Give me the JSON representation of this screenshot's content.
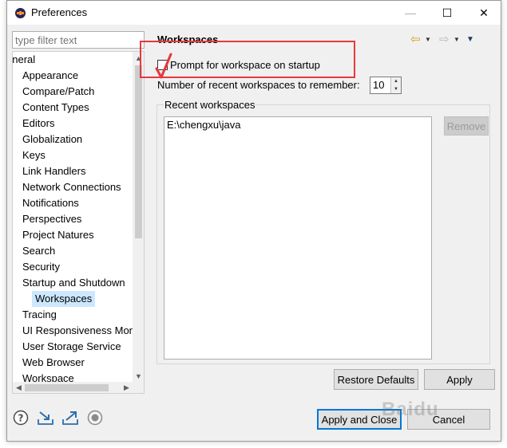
{
  "window": {
    "title": "Preferences"
  },
  "titlebar_buttons": {
    "minimize": "—",
    "maximize": "☐",
    "close": "✕"
  },
  "filter": {
    "placeholder": "type filter text"
  },
  "tree": {
    "items": [
      {
        "label": "eneral",
        "level": 0
      },
      {
        "label": "Appearance",
        "level": 1
      },
      {
        "label": "Compare/Patch",
        "level": 1
      },
      {
        "label": "Content Types",
        "level": 1
      },
      {
        "label": "Editors",
        "level": 1
      },
      {
        "label": "Globalization",
        "level": 1
      },
      {
        "label": "Keys",
        "level": 1
      },
      {
        "label": "Link Handlers",
        "level": 1
      },
      {
        "label": "Network Connections",
        "level": 1
      },
      {
        "label": "Notifications",
        "level": 1
      },
      {
        "label": "Perspectives",
        "level": 1
      },
      {
        "label": "Project Natures",
        "level": 1
      },
      {
        "label": "Search",
        "level": 1
      },
      {
        "label": "Security",
        "level": 1
      },
      {
        "label": "Startup and Shutdown",
        "level": 1
      },
      {
        "label": "Workspaces",
        "level": 2,
        "selected": true
      },
      {
        "label": "Tracing",
        "level": 1
      },
      {
        "label": "UI Responsiveness Moni",
        "level": 1
      },
      {
        "label": "User Storage Service",
        "level": 1
      },
      {
        "label": "Web Browser",
        "level": 1
      },
      {
        "label": "Workspace",
        "level": 1
      }
    ]
  },
  "page": {
    "title": "Workspaces",
    "prompt_checkbox": {
      "label": "Prompt for workspace on startup",
      "checked": false
    },
    "recent_count_label": "Number of recent workspaces to remember:",
    "recent_count_value": "10",
    "recent_group_title": "Recent workspaces",
    "recent_list": [
      "E:\\chengxu\\java"
    ],
    "remove_button": "Remove",
    "restore_defaults_button": "Restore Defaults",
    "apply_button": "Apply"
  },
  "footer": {
    "apply_close_button": "Apply and Close",
    "cancel_button": "Cancel"
  },
  "watermark": "Baidu",
  "colors": {
    "annotation": "#e8383d",
    "selection": "#cce8ff",
    "default_button_border": "#0078d7"
  }
}
